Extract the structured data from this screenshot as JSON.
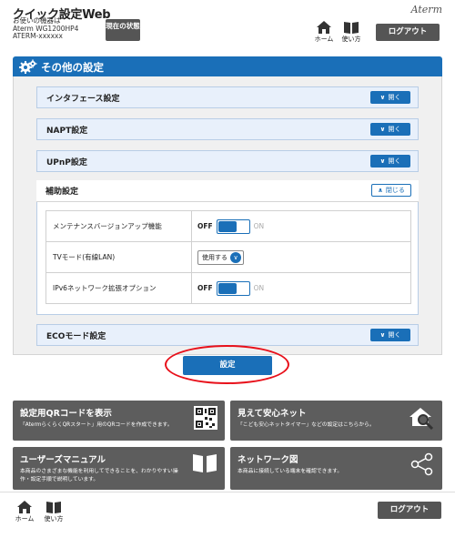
{
  "header": {
    "title": "クイック設定Web",
    "device_label": "お使いの機器は",
    "device_model": "Aterm WG1200HP4",
    "device_id": "ATERM-xxxxxx",
    "status_button": "現在の状態",
    "brand": "Aterm",
    "home_label": "ホーム",
    "help_label": "使い方",
    "logout_label": "ログアウト"
  },
  "section": {
    "title": "その他の設定"
  },
  "accordions": [
    {
      "label": "インタフェース設定",
      "button": "開く"
    },
    {
      "label": "NAPT設定",
      "button": "開く"
    },
    {
      "label": "UPnP設定",
      "button": "開く"
    },
    {
      "label": "補助設定",
      "button": "閉じる"
    },
    {
      "label": "ECOモード設定",
      "button": "開く"
    }
  ],
  "settings": [
    {
      "label": "メンテナンスバージョンアップ機能",
      "off": "OFF",
      "on": "ON"
    },
    {
      "label": "TVモード(有線LAN)",
      "select_value": "使用する"
    },
    {
      "label": "IPv6ネットワーク拡張オプション",
      "off": "OFF",
      "on": "ON"
    }
  ],
  "submit_label": "設定",
  "cards": [
    {
      "title": "設定用QRコードを表示",
      "desc": "「AtermらくらくQRスタート」用のQRコードを作成できます。",
      "icon": "qr-code-icon"
    },
    {
      "title": "見えて安心ネット",
      "desc": "「こども安心ネットタイマー」などの設定はこちらから。",
      "icon": "home-search-icon"
    },
    {
      "title": "ユーザーズマニュアル",
      "desc": "本商品のさまざまな機能を利用してできることを、わかりやすい操作・設定手順で説明しています。",
      "icon": "book-icon"
    },
    {
      "title": "ネットワーク図",
      "desc": "本商品に接続している端末を確認できます。",
      "icon": "network-share-icon"
    }
  ],
  "footer": {
    "home_label": "ホーム",
    "help_label": "使い方",
    "logout_label": "ログアウト"
  },
  "colors": {
    "accent": "#1a6fb8",
    "card_bg": "#5d5d5d",
    "highlight_ring": "#e8101a"
  }
}
